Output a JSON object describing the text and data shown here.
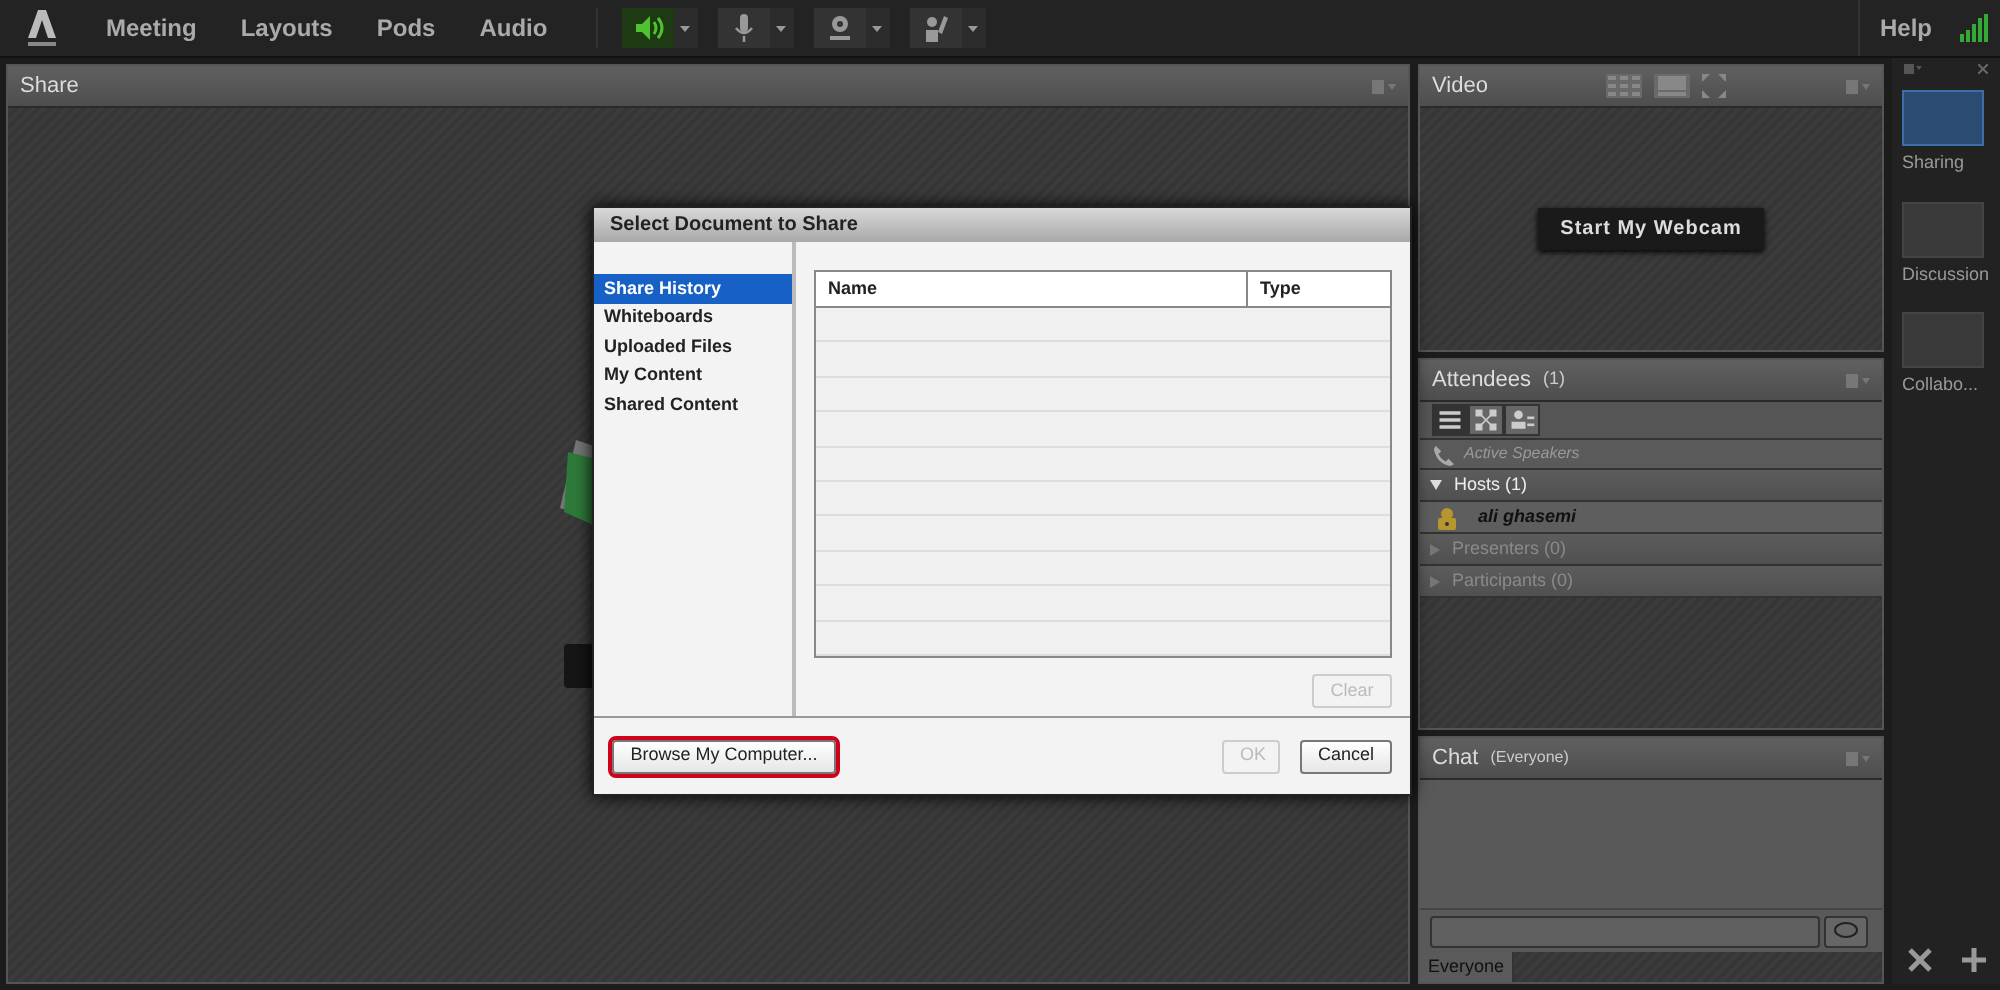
{
  "menu": [
    "Meeting",
    "Layouts",
    "Pods",
    "Audio"
  ],
  "toolbar": [
    {
      "kind": "speaker",
      "on": true
    },
    {
      "kind": "mic",
      "on": false
    },
    {
      "kind": "camera",
      "on": false
    },
    {
      "kind": "hand",
      "on": false
    }
  ],
  "help": "Help",
  "share_pod": {
    "title": "Share"
  },
  "video_pod": {
    "title": "Video",
    "button": "Start My Webcam"
  },
  "attendees_pod": {
    "title": "Attendees",
    "count": "(1)",
    "views": [
      {
        "selected": true
      },
      {
        "selected": false
      },
      {
        "selected": false
      }
    ],
    "active_speakers": "Active Speakers",
    "groups": [
      {
        "label": "Hosts (1)",
        "expanded": true,
        "children": [
          {
            "name": "ali ghasemi"
          }
        ]
      },
      {
        "label": "Presenters (0)",
        "expanded": false
      },
      {
        "label": "Participants (0)",
        "expanded": false
      }
    ]
  },
  "chat_pod": {
    "title": "Chat",
    "scope": "(Everyone)",
    "tab": "Everyone"
  },
  "layouts": [
    {
      "label": "Sharing",
      "selected": true
    },
    {
      "label": "Discussion",
      "selected": false
    },
    {
      "label": "Collabo...",
      "selected": false
    }
  ],
  "dialog": {
    "title": "Select Document to Share",
    "sources": [
      {
        "label": "Share History",
        "selected": true
      },
      {
        "label": "Whiteboards",
        "selected": false
      },
      {
        "label": "Uploaded Files",
        "selected": false
      },
      {
        "label": "My Content",
        "selected": false
      },
      {
        "label": "Shared Content",
        "selected": false
      }
    ],
    "columns": [
      "Name",
      "Type"
    ],
    "buttons": [
      {
        "kind": "clear",
        "label": "Clear",
        "disabled": true
      },
      {
        "kind": "browse",
        "label": "Browse My Computer...",
        "disabled": false,
        "highlighted": true
      },
      {
        "kind": "ok",
        "label": "OK",
        "disabled": true
      },
      {
        "kind": "cancel",
        "label": "Cancel",
        "disabled": false
      }
    ]
  }
}
